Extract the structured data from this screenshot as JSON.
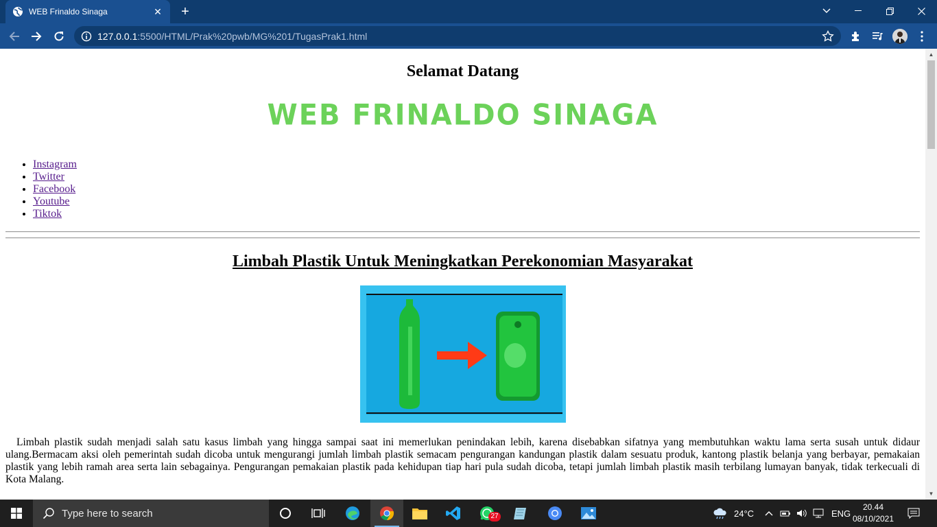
{
  "browser": {
    "tab_title": "WEB Frinaldo Sinaga",
    "url_host": "127.0.0.1",
    "url_rest": ":5500/HTML/Prak%20pwb/MG%201/TugasPrak1.html"
  },
  "page": {
    "welcome": "Selamat Datang",
    "site_title": "WEB FRINALDO SINAGA",
    "links": [
      "Instagram",
      "Twitter",
      "Facebook",
      "Youtube",
      "Tiktok"
    ],
    "article_title": "Limbah Plastik Untuk Meningkatkan Perekonomian Masyarakat",
    "paragraph1": "Limbah plastik sudah menjadi salah satu kasus limbah yang hingga sampai saat ini memerlukan penindakan lebih, karena disebabkan sifatnya yang membutuhkan waktu lama serta susah untuk didaur ulang.Bermacam aksi oleh pemerintah sudah dicoba untuk mengurangi jumlah limbah plastik semacam pengurangan kandungan plastik dalam sesuatu produk, kantong plastik belanja yang berbayar, pemakaian plastik yang lebih ramah area serta lain sebagainya. Pengurangan pemakaian plastik pada kehidupan tiap hari pula sudah dicoba, tetapi jumlah limbah plastik masih terbilang lumayan banyak, tidak terkecuali di Kota Malang."
  },
  "taskbar": {
    "search_placeholder": "Type here to search",
    "whatsapp_badge": "27",
    "weather": "24°C",
    "language": "ENG",
    "time": "20.44",
    "date": "08/10/2021"
  },
  "colors": {
    "site_title": "#6cd25a",
    "chrome_dark": "#0f3c6e",
    "chrome_light": "#1a5091",
    "figure_bg": "#37c2f0"
  }
}
